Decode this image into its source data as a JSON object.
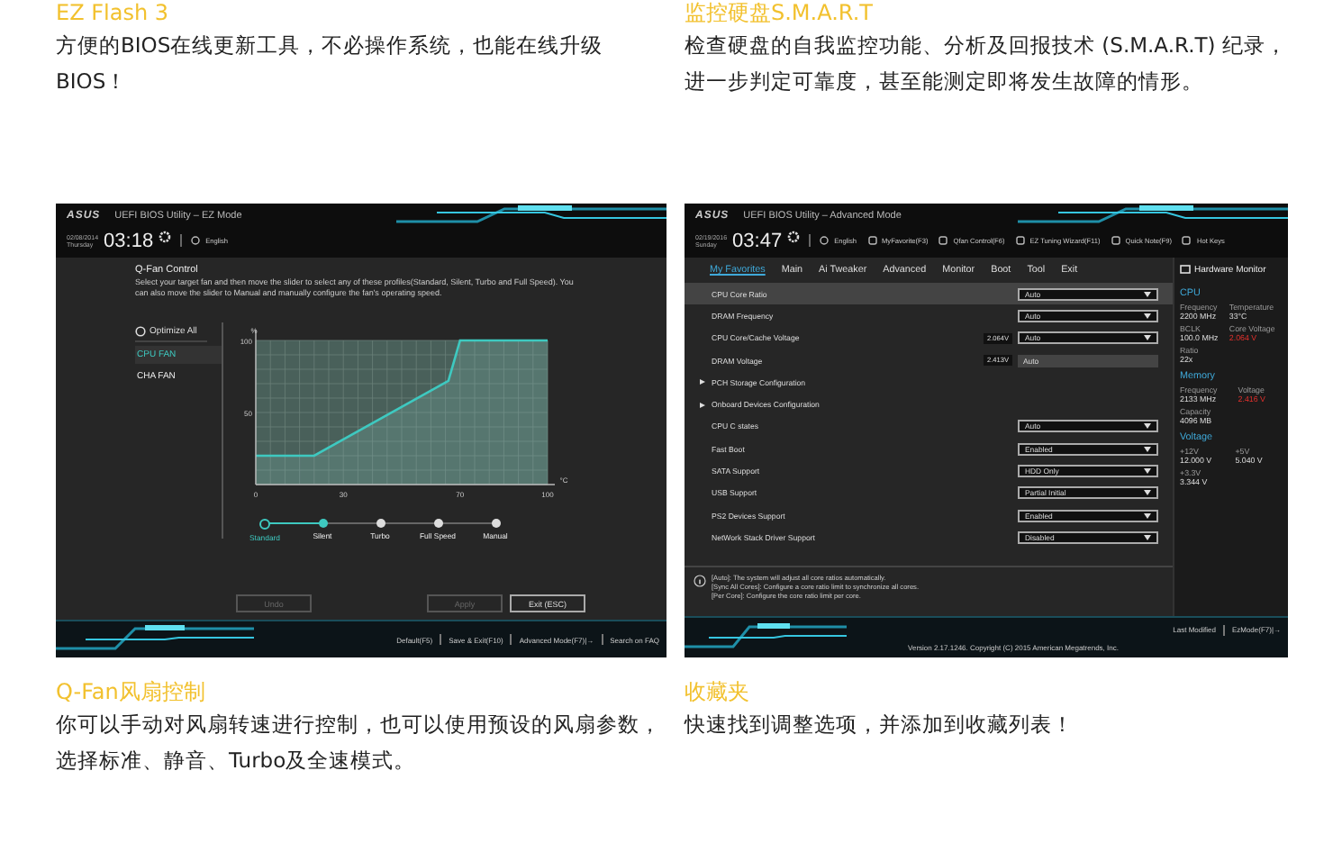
{
  "features_top": [
    {
      "heading": "EZ Flash 3",
      "text": "方便的BIOS在线更新工具，不必操作系统，也能在线升级BIOS！"
    },
    {
      "heading": "监控硬盘S.M.A.R.T",
      "text": "检查硬盘的自我监控功能、分析及回报技术 (S.M.A.R.T) 纪录，进一步判定可靠度，甚至能测定即将发生故障的情形。"
    }
  ],
  "ez_mode": {
    "logo": "ASUS",
    "title": "UEFI BIOS Utility – EZ Mode",
    "date": "02/08/2014",
    "weekday": "Thursday",
    "time": "03:18",
    "language": "English",
    "panel_title": "Q-Fan Control",
    "description": "Select your target fan and then move the slider to select any of these profiles(Standard, Silent, Turbo and Full Speed). You can also move the slider to Manual and manually configure the fan's operating speed.",
    "optimize": "Optimize All",
    "fans": [
      {
        "label": "CPU FAN",
        "selected": true
      },
      {
        "label": "CHA FAN",
        "selected": false
      }
    ],
    "chart_data": {
      "type": "area",
      "grid": true,
      "xlabel": "°C",
      "ylabel": "%",
      "x": [
        0,
        20,
        66,
        70,
        100
      ],
      "series": [
        {
          "color": "#3ec9c0",
          "values": [
            20,
            20,
            72,
            100,
            100
          ]
        }
      ],
      "xlim": [
        0,
        100
      ],
      "ylim": [
        0,
        100
      ],
      "xticks": [
        0,
        30,
        70,
        100
      ],
      "yticks": [
        50,
        100
      ]
    },
    "profiles": [
      {
        "label": "Standard",
        "selected": true,
        "filled": false
      },
      {
        "label": "Silent",
        "selected": false,
        "filled": true
      },
      {
        "label": "Turbo",
        "selected": false,
        "filled": false
      },
      {
        "label": "Full Speed",
        "selected": false,
        "filled": false
      },
      {
        "label": "Manual",
        "selected": false,
        "filled": false
      }
    ],
    "buttons": [
      {
        "label": "Undo",
        "disabled": true
      },
      {
        "label": "Apply",
        "disabled": true
      },
      {
        "label": "Exit (ESC)",
        "disabled": false
      }
    ],
    "footer": [
      "Default(F5)",
      "Save & Exit(F10)",
      "Advanced Mode(F7)|→",
      "Search on FAQ"
    ]
  },
  "advanced_mode": {
    "logo": "ASUS",
    "title": "UEFI BIOS Utility – Advanced Mode",
    "date": "02/19/2016",
    "weekday": "Sunday",
    "time": "03:47",
    "language": "English",
    "toolbar": [
      "MyFavorite(F3)",
      "Qfan Control(F6)",
      "EZ Tuning Wizard(F11)",
      "Quick Note(F9)",
      "Hot Keys"
    ],
    "tabs": [
      {
        "label": "My Favorites",
        "selected": true
      },
      {
        "label": "Main",
        "selected": false
      },
      {
        "label": "Ai Tweaker",
        "selected": false
      },
      {
        "label": "Advanced",
        "selected": false
      },
      {
        "label": "Monitor",
        "selected": false
      },
      {
        "label": "Boot",
        "selected": false
      },
      {
        "label": "Tool",
        "selected": false
      },
      {
        "label": "Exit",
        "selected": false
      }
    ],
    "rows": [
      {
        "kind": "dropdown",
        "label": "CPU Core Ratio",
        "value": "Auto",
        "selected": true
      },
      {
        "kind": "dropdown",
        "label": "DRAM Frequency",
        "value": "Auto",
        "selected": false
      },
      {
        "kind": "dropdown",
        "label": "CPU Core/Cache Voltage",
        "reading": "2.064V",
        "value": "Auto",
        "selected": false
      },
      {
        "kind": "field",
        "label": "DRAM Voltage",
        "reading": "2.413V",
        "value": "Auto",
        "selected": false
      },
      {
        "kind": "submenu",
        "label": "PCH Storage Configuration",
        "selected": false
      },
      {
        "kind": "submenu",
        "label": "Onboard Devices Configuration",
        "selected": false
      },
      {
        "kind": "dropdown",
        "label": "CPU C states",
        "value": "Auto",
        "selected": false
      },
      {
        "kind": "dropdown",
        "label": "Fast Boot",
        "value": "Enabled",
        "selected": false
      },
      {
        "kind": "dropdown",
        "label": "SATA Support",
        "value": "HDD Only",
        "selected": false
      },
      {
        "kind": "dropdown",
        "label": "USB Support",
        "value": "Partial Initial",
        "selected": false
      },
      {
        "kind": "dropdown",
        "label": "PS2 Devices Support",
        "value": "Enabled",
        "selected": false
      },
      {
        "kind": "dropdown",
        "label": "NetWork Stack Driver Support",
        "value": "Disabled",
        "selected": false
      }
    ],
    "help": [
      "[Auto]: The system will adjust all core ratios automatically.",
      "[Sync All Cores]: Configure a core ratio limit to synchronize all cores.",
      "[Per Core]: Configure the core ratio limit per core."
    ],
    "monitor_title": "Hardware Monitor",
    "monitor": [
      {
        "section": "CPU",
        "stats": [
          {
            "label": "Frequency",
            "value": "2200 MHz",
            "alert": false
          },
          {
            "label": "Temperature",
            "value": "33°C",
            "alert": false
          },
          {
            "label": "BCLK",
            "value": "100.0 MHz",
            "alert": false
          },
          {
            "label": "Core Voltage",
            "value": "2.064 V",
            "alert": true
          },
          {
            "label": "Ratio",
            "value": "22x",
            "alert": false
          }
        ]
      },
      {
        "section": "Memory",
        "stats": [
          {
            "label": "Frequency",
            "value": "2133 MHz",
            "alert": false
          },
          {
            "label": "Voltage",
            "value": "2.416 V",
            "alert": true
          },
          {
            "label": "Capacity",
            "value": "4096 MB",
            "alert": false
          }
        ]
      },
      {
        "section": "Voltage",
        "stats": [
          {
            "label": "+12V",
            "value": "12.000 V",
            "alert": false
          },
          {
            "label": "+5V",
            "value": "5.040 V",
            "alert": false
          },
          {
            "label": "+3.3V",
            "value": "3.344 V",
            "alert": false
          }
        ]
      }
    ],
    "footer": [
      "Last Modified",
      "EzMode(F7)|→"
    ],
    "version": "Version 2.17.1246. Copyright (C) 2015 American Megatrends, Inc."
  },
  "features_bottom": [
    {
      "heading": "Q-Fan风扇控制",
      "text": "你可以手动对风扇转速进行控制，也可以使用预设的风扇参数，选择标准、静音、Turbo及全速模式。"
    },
    {
      "heading": "收藏夹",
      "text": "快速找到调整选项，并添加到收藏列表！"
    }
  ]
}
